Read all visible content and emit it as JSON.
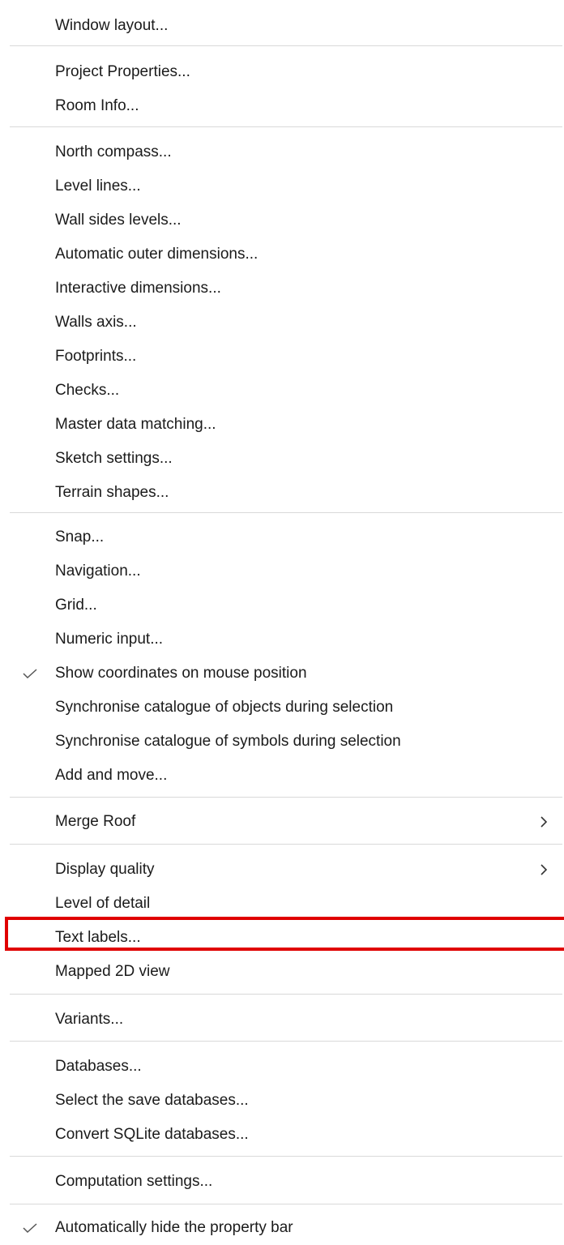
{
  "menu": {
    "items": [
      {
        "label": "Window layout..."
      },
      {
        "label": "Project Properties..."
      },
      {
        "label": "Room Info..."
      },
      {
        "label": "North compass..."
      },
      {
        "label": "Level lines..."
      },
      {
        "label": "Wall sides levels..."
      },
      {
        "label": "Automatic outer dimensions..."
      },
      {
        "label": "Interactive dimensions..."
      },
      {
        "label": "Walls axis..."
      },
      {
        "label": "Footprints..."
      },
      {
        "label": "Checks..."
      },
      {
        "label": "Master data matching..."
      },
      {
        "label": "Sketch settings..."
      },
      {
        "label": "Terrain shapes..."
      },
      {
        "label": "Snap..."
      },
      {
        "label": "Navigation..."
      },
      {
        "label": "Grid..."
      },
      {
        "label": "Numeric input..."
      },
      {
        "label": "Show coordinates on mouse position",
        "checked": true
      },
      {
        "label": "Synchronise catalogue of objects during selection"
      },
      {
        "label": "Synchronise catalogue of symbols during selection"
      },
      {
        "label": "Add and move..."
      },
      {
        "label": "Merge Roof",
        "submenu": true
      },
      {
        "label": "Display quality",
        "submenu": true
      },
      {
        "label": "Level of detail"
      },
      {
        "label": "Text labels...",
        "highlighted": true
      },
      {
        "label": "Mapped 2D view"
      },
      {
        "label": "Variants..."
      },
      {
        "label": "Databases..."
      },
      {
        "label": "Select the save databases..."
      },
      {
        "label": "Convert SQLite databases..."
      },
      {
        "label": "Computation settings..."
      },
      {
        "label": "Automatically hide the property bar",
        "checked": true
      }
    ]
  },
  "colors": {
    "highlight_border": "#e00000",
    "separator": "#d9d9d9",
    "text": "#1b1b1b"
  }
}
